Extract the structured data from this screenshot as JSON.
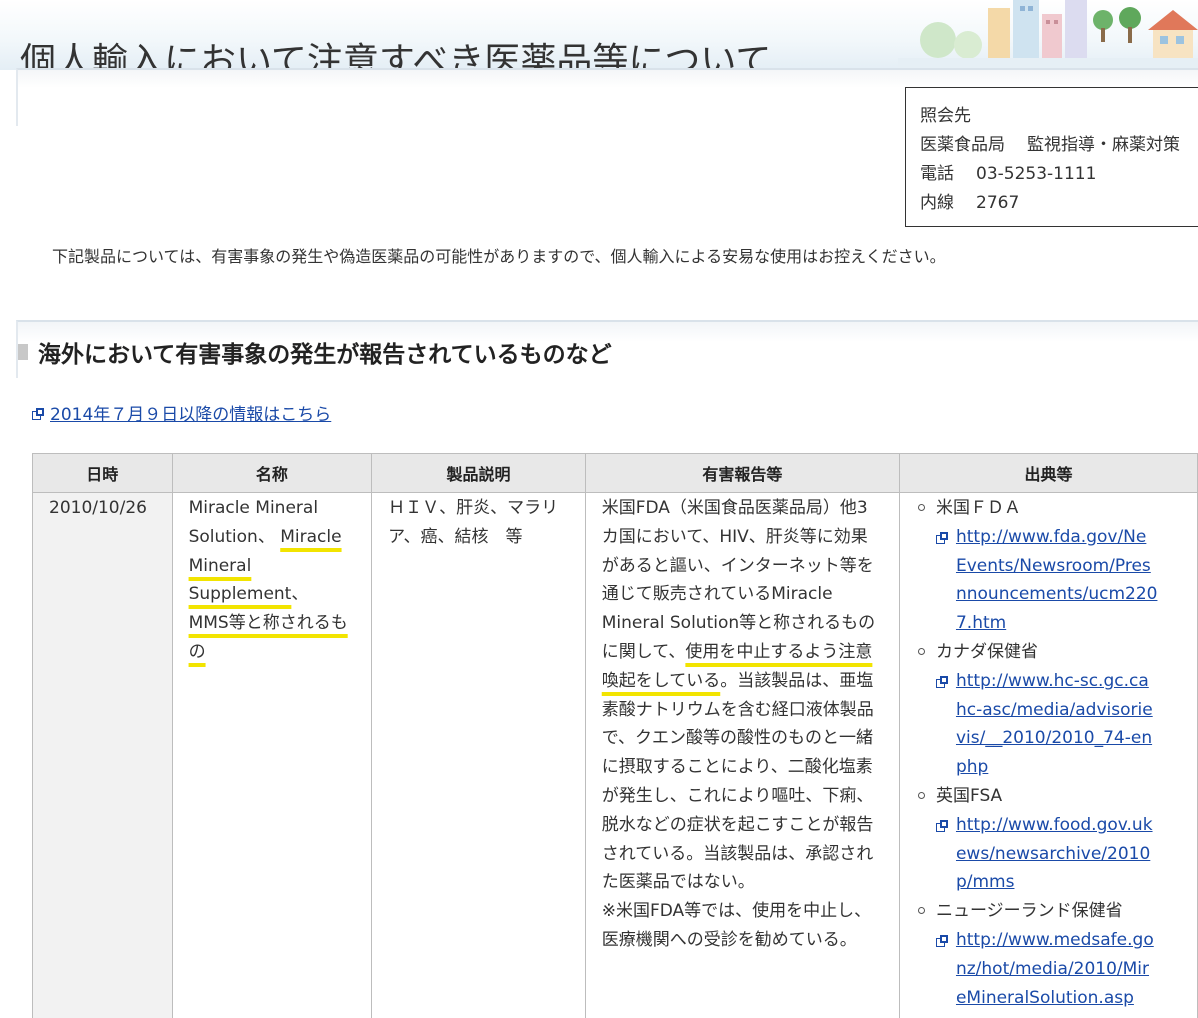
{
  "page": {
    "title": "個人輸入において注意すべき医薬品等について"
  },
  "contact": {
    "heading": "照会先",
    "department": "医薬食品局",
    "division": "監視指導・麻薬対策",
    "phone_label": "電話",
    "phone": "03-5253-1111",
    "ext_label": "内線",
    "ext": "2767"
  },
  "intro": "下記製品については、有害事象の発生や偽造医薬品の可能性がありますので、個人輸入による安易な使用はお控えください。",
  "section": {
    "heading": "海外において有害事象の発生が報告されているものなど",
    "link_text": "2014年７月９日以降の情報はこちら"
  },
  "table": {
    "headers": [
      "日時",
      "名称",
      "製品説明",
      "有害報告等",
      "出典等"
    ],
    "row": {
      "date": "2010/10/26",
      "name": {
        "lines": [
          "Miracle Mineral",
          "Solution、 ",
          "Miracle",
          "Mineral",
          "Supplement",
          "、",
          "MMS等と称されるも",
          "の"
        ]
      },
      "description": [
        "ＨＩＶ、肝炎、マラリ",
        "ア、癌、結核　等"
      ],
      "report": {
        "part1": [
          "米国FDA（米国食品医薬品局）他3",
          "カ国において、HIV、肝炎等に効果",
          "があると謳い、インターネット等を",
          "通じて販売されているMiracle",
          "Mineral Solution等と称されるもの",
          "に関して、"
        ],
        "hl1": "使用を中止するよう注意",
        "hl2": "喚起をしている",
        "part2": [
          "。当該製品は、亜塩",
          "素酸ナトリウムを含む経口液体製品",
          "で、クエン酸等の酸性のものと一緒",
          "に摂取することにより、二酸化塩素",
          "が発生し、これにより嘔吐、下痢、",
          "脱水などの症状を起こすことが報告",
          "されている。当該製品は、承認され",
          "た医薬品ではない。",
          "※米国FDA等では、使用を中止し、",
          "医療機関への受診を勧めている。"
        ]
      },
      "sources": [
        {
          "agency": "米国ＦＤＡ",
          "url_lines": [
            "http://www.fda.gov/Ne",
            "Events/Newsroom/Pres",
            "nnouncements/ucm220",
            "7.htm"
          ]
        },
        {
          "agency": "カナダ保健省",
          "url_lines": [
            "http://www.hc-sc.gc.ca",
            "hc-asc/media/advisorie",
            "vis/__2010/2010_74-en",
            "php"
          ]
        },
        {
          "agency": "英国FSA",
          "url_lines": [
            "http://www.food.gov.uk",
            "ews/newsarchive/2010",
            "p/mms"
          ]
        },
        {
          "agency": "ニュージーランド保健省",
          "url_lines": [
            "http://www.medsafe.go",
            "nz/hot/media/2010/Mir",
            "eMineralSolution.asp"
          ]
        }
      ]
    }
  }
}
